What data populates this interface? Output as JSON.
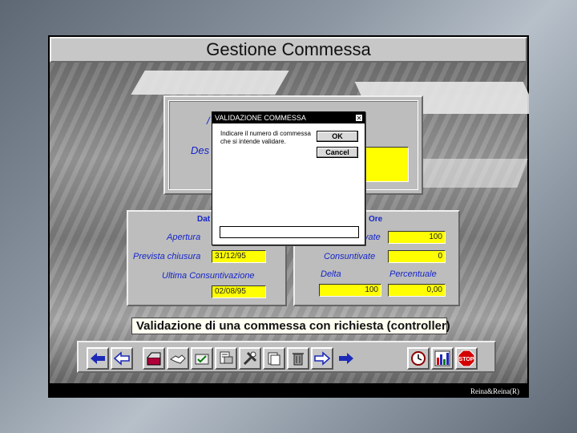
{
  "window_title": "Gestione Commessa",
  "top_panel": {
    "label_partial_1": "/",
    "label_partial_2": "Des"
  },
  "dates_panel": {
    "header": "Dat",
    "apertura_label": "Apertura",
    "prevista_chiusura_label": "Prevista chiusura",
    "prevista_chiusura_value": "31/12/95",
    "ultima_consuntivazione_label": "Ultima   Consuntivazione",
    "ultima_consuntivazione_value": "02/08/95"
  },
  "hours_panel": {
    "header": "Ore",
    "preventivate_label_partial": "vate",
    "preventivate_value": "100",
    "consuntivate_label": "Consuntivate",
    "consuntivate_value": "0",
    "delta_label": "Delta",
    "delta_value": "100",
    "percentuale_label": "Percentuale",
    "percentuale_value": "0,00"
  },
  "dialog": {
    "title": "VALIDAZIONE COMMESSA",
    "close_glyph": "✕",
    "message": "Indicare il numero di commessa che si intende validare.",
    "ok_label": "OK",
    "cancel_label": "Cancel",
    "input_value": ""
  },
  "caption": "Validazione di una commessa con richiesta (controller)",
  "toolbar": {
    "buttons": [
      {
        "icon": "arrow-left-filled-icon",
        "color": "#1d2ab8"
      },
      {
        "icon": "arrow-left-outline-icon",
        "color": "#1d2ab8"
      },
      {
        "icon": "open-box-icon",
        "color": "#b0003a"
      },
      {
        "icon": "handshake-icon",
        "color": "#555555"
      },
      {
        "icon": "folder-check-icon",
        "color": "#555555"
      },
      {
        "icon": "print-preview-icon",
        "color": "#555555"
      },
      {
        "icon": "tools-icon",
        "color": "#555555"
      },
      {
        "icon": "documents-icon",
        "color": "#555555"
      },
      {
        "icon": "trash-icon",
        "color": "#555555"
      },
      {
        "icon": "arrow-right-outline-icon",
        "color": "#1d2ab8"
      },
      {
        "icon": "arrow-right-filled-icon",
        "color": "#1d2ab8"
      },
      {
        "icon": "clock-icon",
        "color": "#8b0000"
      },
      {
        "icon": "bar-chart-icon",
        "color": "#1d2ab8"
      },
      {
        "icon": "stop-icon",
        "color": "#d40000"
      }
    ],
    "stop_label": "STOP"
  },
  "footer": "Reina&Reina(R)"
}
